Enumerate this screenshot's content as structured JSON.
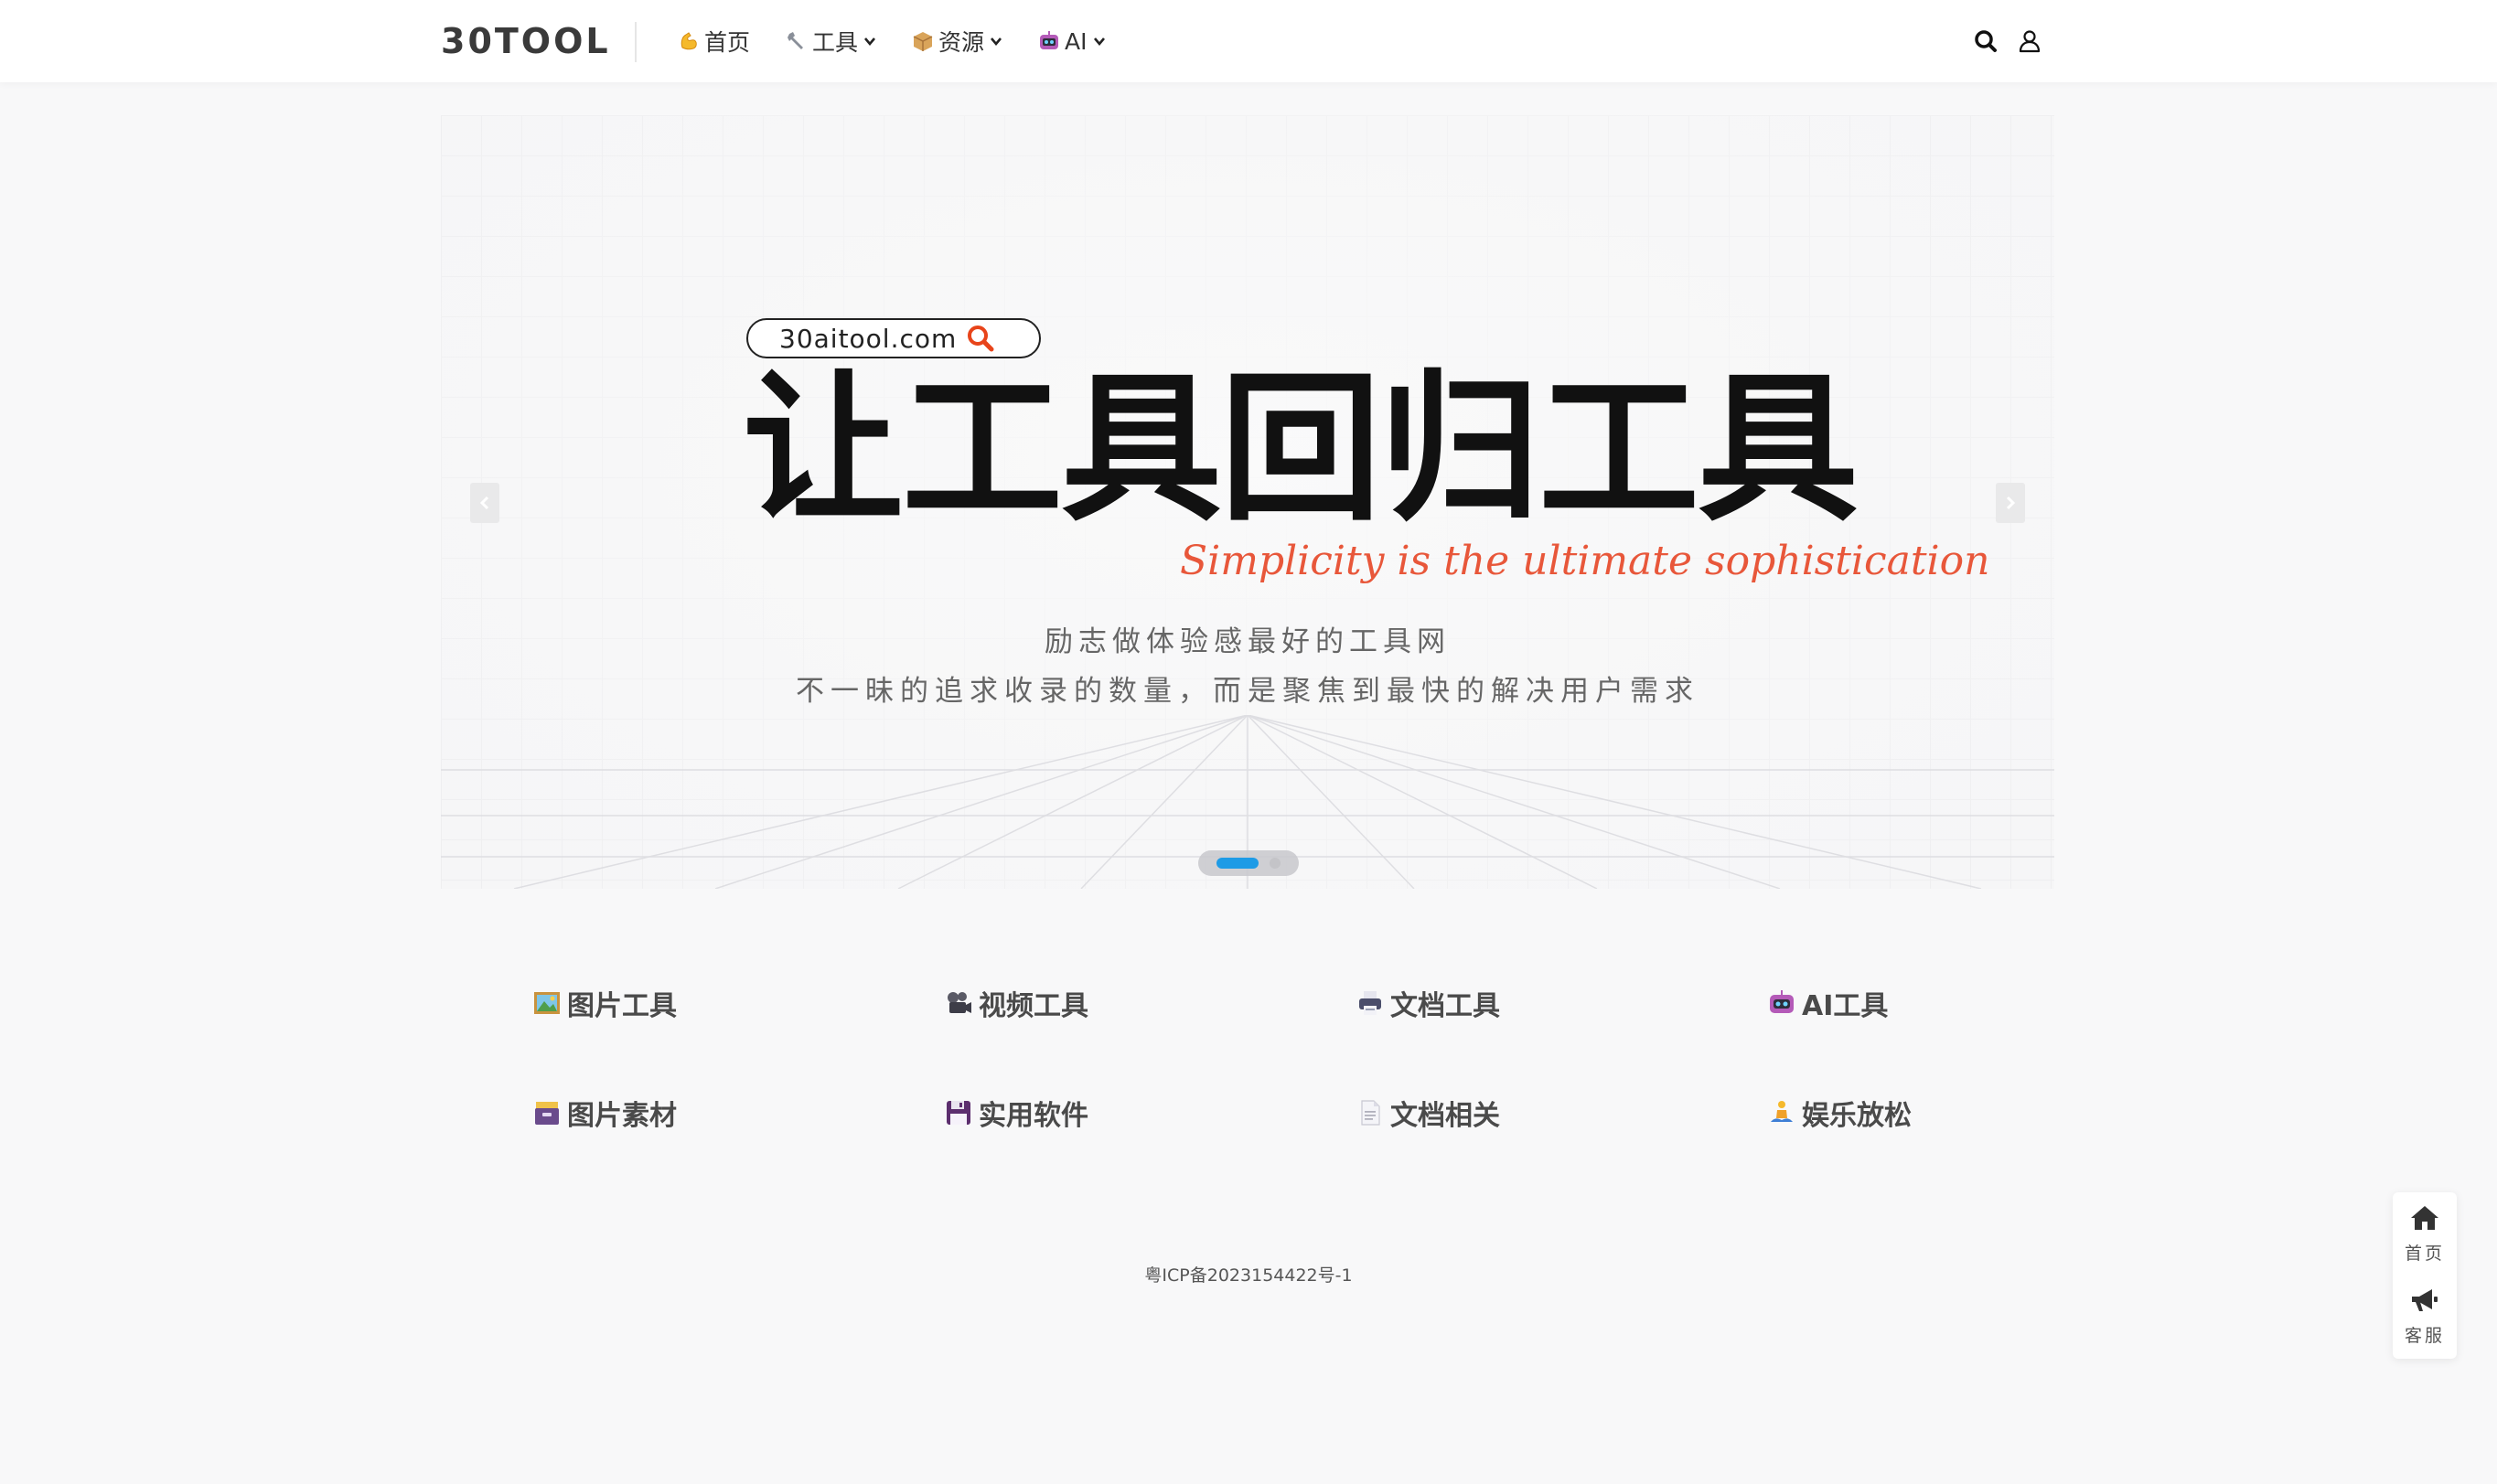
{
  "header": {
    "logo": "30TOOL",
    "nav": [
      {
        "label": "首页",
        "icon": "flexed-biceps-icon",
        "has_dropdown": false
      },
      {
        "label": "工具",
        "icon": "wrench-icon",
        "has_dropdown": true
      },
      {
        "label": "资源",
        "icon": "package-icon",
        "has_dropdown": true
      },
      {
        "label": "AI",
        "icon": "robot-icon",
        "has_dropdown": true
      }
    ],
    "search_icon": "search-icon",
    "user_icon": "user-icon"
  },
  "banner": {
    "url_text": "30aitool.com",
    "title": "让工具回归工具",
    "script_text": "Simplicity is the ultimate sophistication",
    "line1": "励志做体验感最好的工具网",
    "line2": "不一昧的追求收录的数量，而是聚焦到最快的解决用户需求",
    "slides_total": 2,
    "slide_active": 1,
    "accent_color": "#1e9be6",
    "script_color": "#e8573a"
  },
  "categories": [
    {
      "label": "图片工具",
      "icon": "framed-picture-icon"
    },
    {
      "label": "视频工具",
      "icon": "film-projector-icon"
    },
    {
      "label": "文档工具",
      "icon": "printer-icon"
    },
    {
      "label": "AI工具",
      "icon": "robot-icon"
    },
    {
      "label": "图片素材",
      "icon": "card-file-box-icon"
    },
    {
      "label": "实用软件",
      "icon": "floppy-disk-icon"
    },
    {
      "label": "文档相关",
      "icon": "page-facing-up-icon"
    },
    {
      "label": "娱乐放松",
      "icon": "person-in-lotus-position-icon"
    }
  ],
  "footer": {
    "icp": "粤ICP备2023154422号-1"
  },
  "side": {
    "home_label": "首页",
    "service_label": "客服"
  }
}
